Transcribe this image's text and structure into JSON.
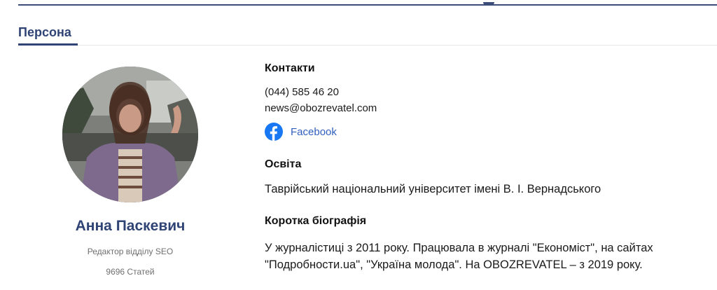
{
  "section": {
    "title": "Персона"
  },
  "profile": {
    "name": "Анна Паскевич",
    "role": "Редактор відділу SEO",
    "articles_count": "9696 Статей"
  },
  "contacts": {
    "heading": "Контакти",
    "phone": "(044) 585 46 20",
    "email": "news@obozrevatel.com",
    "facebook_label": "Facebook",
    "facebook_icon": "facebook-icon"
  },
  "education": {
    "heading": "Освіта",
    "text": "Таврійський національний університет імені В. І. Вернадського"
  },
  "bio": {
    "heading": "Коротка біографія",
    "line1": "У журналістиці з 2011 року. Працювала в журналі \"Економіст\", на сайтах",
    "line2": "\"Подробности.ua\", \"Україна молода\". На OBOZREVATEL – з 2019 року."
  },
  "colors": {
    "brand": "#2f4374",
    "link": "#2f5fbd",
    "facebook": "#1877f2"
  }
}
